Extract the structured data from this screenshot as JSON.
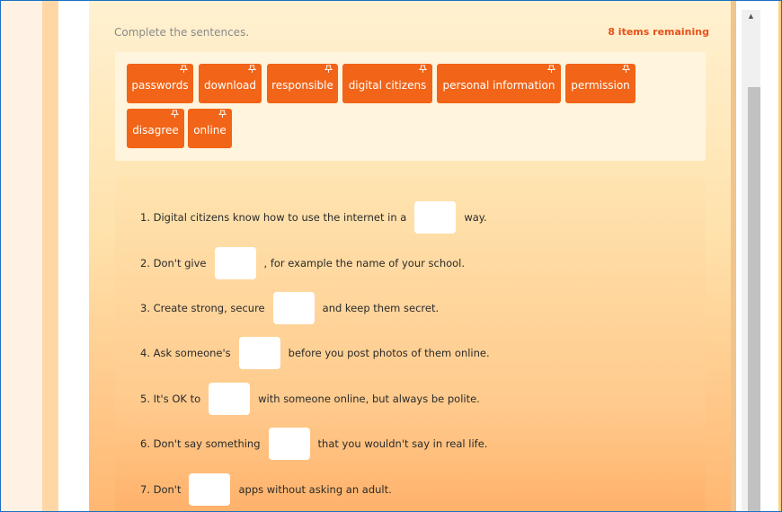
{
  "activity": {
    "instruction": "Complete the sentences.",
    "remaining": "8 items remaining"
  },
  "word_bank": [
    "passwords",
    "download",
    "responsible",
    "digital citizens",
    "personal information",
    "permission",
    "disagree",
    "online"
  ],
  "sentences": [
    {
      "before": "1. Digital citizens know how to use the internet in a",
      "after": "way."
    },
    {
      "before": "2. Don't give",
      "after": ", for example the name of your school."
    },
    {
      "before": "3. Create strong, secure",
      "after": "and keep them secret."
    },
    {
      "before": "4. Ask someone's",
      "after": "before you post photos of them online."
    },
    {
      "before": "5. It's OK to",
      "after": "with someone online, but always be polite."
    },
    {
      "before": "6. Don't say something",
      "after": "that you wouldn't say in real life."
    },
    {
      "before": "7. Don't",
      "after": "apps without asking an adult."
    }
  ],
  "colors": {
    "chip": "#f26417",
    "remaining": "#e8521b",
    "frame_border": "#1b6fc2"
  },
  "icons": {
    "chip_pin": "pin-icon",
    "scroll_up": "scroll-up-arrow-icon"
  }
}
